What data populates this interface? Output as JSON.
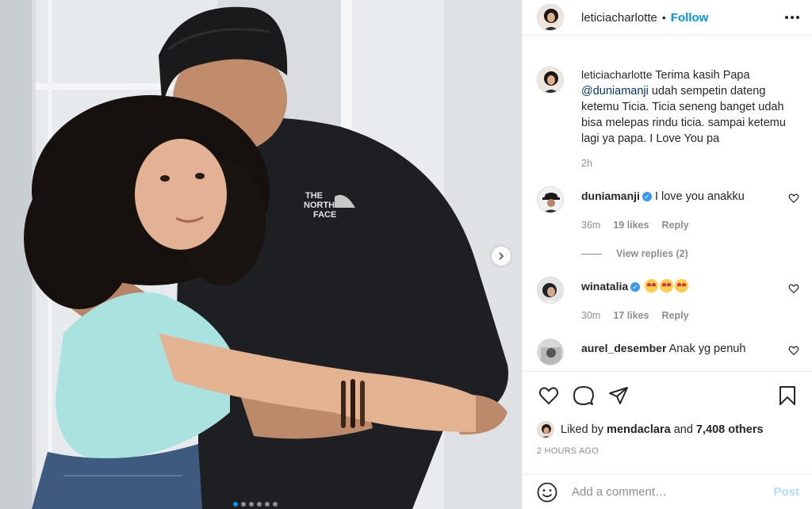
{
  "post": {
    "author": "leticiacharlotte",
    "separator": "•",
    "follow_label": "Follow",
    "carousel": {
      "slide_count": 6,
      "active_index": 0
    }
  },
  "caption": {
    "author": "leticiacharlotte",
    "text_before": "Terima kasih Papa",
    "mention": "@duniamanji",
    "text_after": "udah sempetin dateng ketemu Ticia. Ticia seneng banget udah bisa melepas rindu ticia. sampai ketemu lagi ya papa. I Love You pa",
    "time": "2h"
  },
  "comments": [
    {
      "username": "duniamanji",
      "verified": "✓",
      "text": "I love you anakku",
      "time": "36m",
      "likes": "19 likes",
      "reply": "Reply",
      "view_replies": "View replies (2)"
    },
    {
      "username": "winatalia",
      "verified": "✓",
      "text": "",
      "emojis": [
        "heart-eyes-emoji",
        "heart-eyes-emoji",
        "heart-eyes-emoji"
      ],
      "time": "30m",
      "likes": "17 likes",
      "reply": "Reply"
    },
    {
      "username": "aurel_desember",
      "text": "Anak yg penuh"
    }
  ],
  "likes": {
    "prefix": "Liked by",
    "user": "mendaclara",
    "suffix": "and",
    "others": "7,408 others"
  },
  "timestamp": "2 HOURS AGO",
  "add_comment": {
    "placeholder": "Add a comment…",
    "post_label": "Post"
  },
  "colors": {
    "accent": "#0095f6",
    "link": "#00376b",
    "muted": "#8e8e8e",
    "post_disabled": "#b3dbff"
  }
}
